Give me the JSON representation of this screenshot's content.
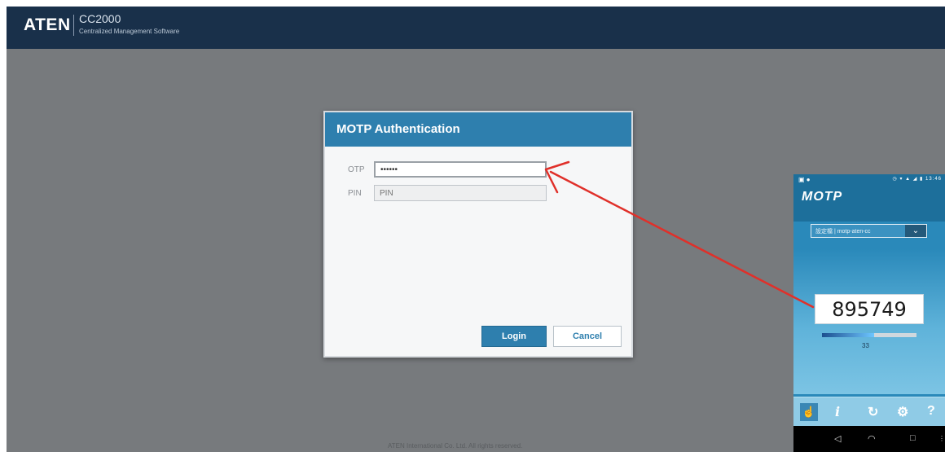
{
  "app": {
    "logo": "ATEN",
    "product": "CC2000",
    "subtitle": "Centralized Management Software",
    "footer": "ATEN International Co. Ltd. All rights reserved."
  },
  "dialog": {
    "title": "MOTP Authentication",
    "otp_label": "OTP",
    "otp_value": "••••••",
    "pin_label": "PIN",
    "pin_placeholder": "PIN",
    "login_label": "Login",
    "cancel_label": "Cancel"
  },
  "phone": {
    "status_left": "▣ ●",
    "status_right": "◷ ▾ ▲ ◢ ▮ 13:46",
    "app_logo": "MOTP",
    "profile_name": "設定檔 | motp-aten-cc",
    "dropdown_icon": "chevron-down-icon",
    "dropdown_glyph": "⌄",
    "otp_code": "895749",
    "countdown": "33",
    "countdown_fraction": 0.55,
    "toolbar": {
      "touch": "☝",
      "info": "i",
      "refresh": "↻",
      "settings": "⚙",
      "help": "?"
    },
    "nav": {
      "back": "◁",
      "home": "◠",
      "recent": "□",
      "more": "⋮"
    }
  },
  "colors": {
    "header_bg": "#19304a",
    "page_bg": "#777a7d",
    "accent": "#2e7fae",
    "arrow": "#e0302a"
  }
}
